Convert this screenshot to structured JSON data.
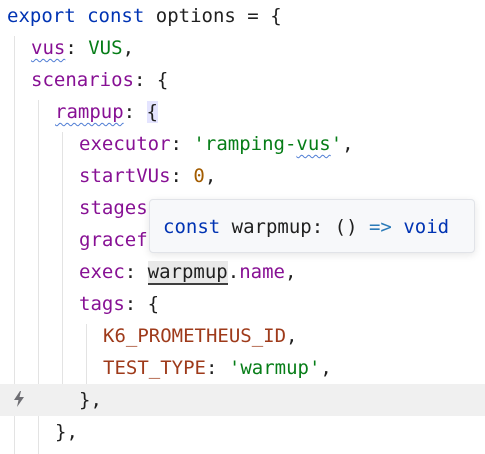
{
  "editor": {
    "lines": [
      {
        "kw1": "export",
        "kw2": "const",
        "name": "options",
        "eq": "=",
        "brace": "{"
      },
      {
        "key": "vus",
        "colon": ":",
        "value": "VUS",
        "comma": ","
      },
      {
        "key": "scenarios",
        "colon": ":",
        "brace": "{"
      },
      {
        "key": "rampup",
        "colon": ":",
        "brace": "{"
      },
      {
        "key": "executor",
        "colon": ":",
        "q1": "'",
        "value_a": "ramping-",
        "value_b": "vus",
        "q2": "'",
        "comma": ","
      },
      {
        "key": "startVUs",
        "colon": ":",
        "value": "0",
        "comma": ","
      },
      {
        "key": "stages"
      },
      {
        "key": "gracef"
      },
      {
        "key": "exec",
        "colon": ":",
        "ref": "warpmup",
        "dot": ".",
        "prop": "name",
        "comma": ","
      },
      {
        "key": "tags",
        "colon": ":",
        "brace": "{"
      },
      {
        "value": "K6_PROMETHEUS_ID",
        "comma": ","
      },
      {
        "key": "TEST_TYPE",
        "colon": ":",
        "q1": "'",
        "value": "warmup",
        "q2": "'",
        "comma": ","
      },
      {
        "close": "},"
      },
      {
        "close": "},"
      }
    ]
  },
  "tooltip": {
    "kw": "const",
    "name": "warpmup",
    "colon": ":",
    "sig": "()",
    "arrow": "=>",
    "ret": "void"
  },
  "gutter": {
    "icon": "lightning-icon"
  }
}
